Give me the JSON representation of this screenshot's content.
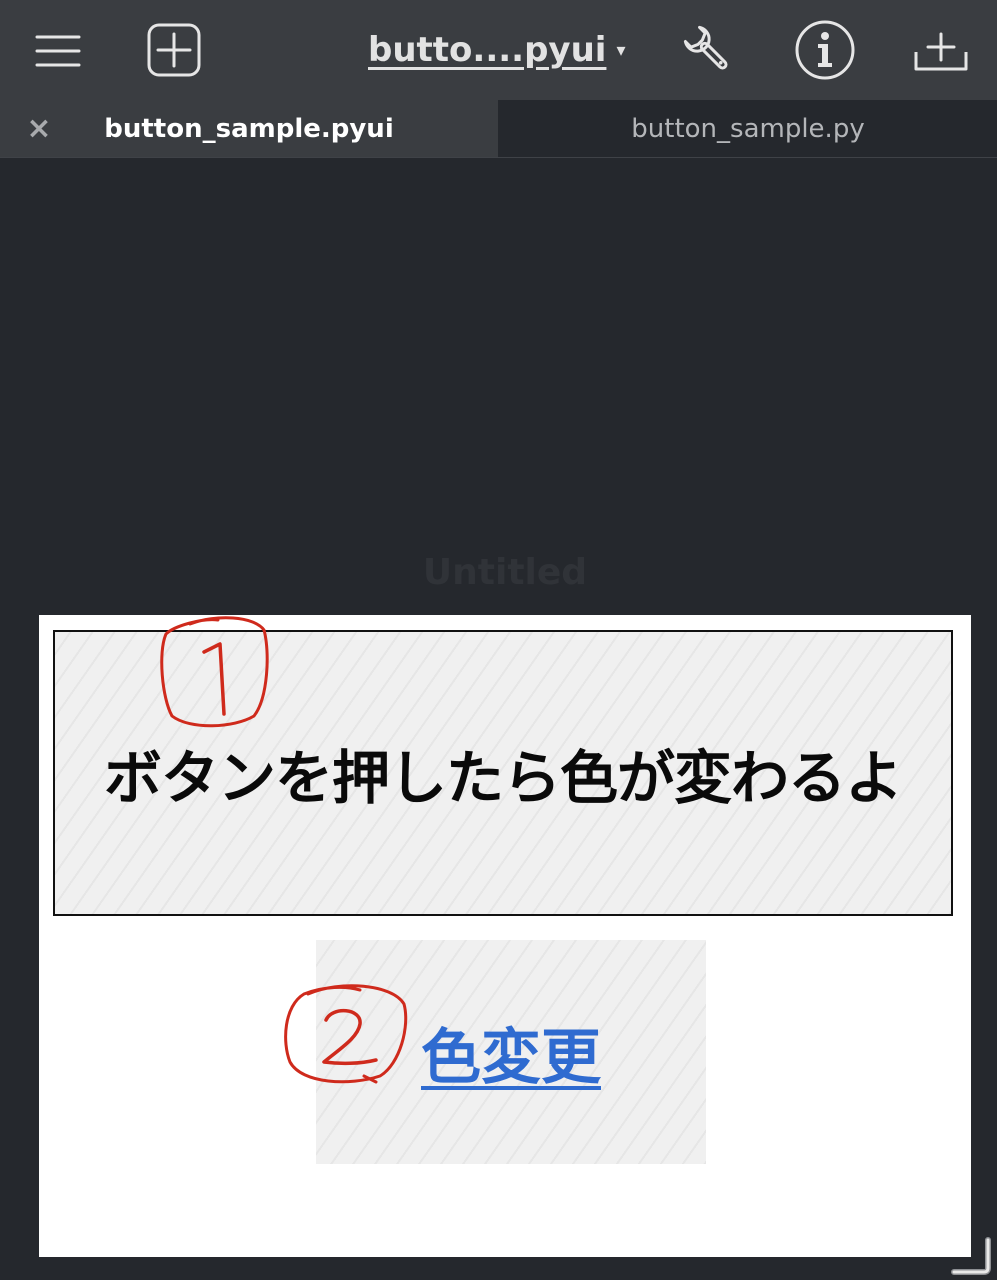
{
  "toolbar": {
    "menu_icon": "hamburger-menu-icon",
    "add_icon": "plus-square-icon",
    "title": "butto....pyui",
    "title_caret": "▾",
    "wrench_icon": "wrench-icon",
    "info_icon": "info-circle-icon",
    "add_subview_icon": "add-tray-icon"
  },
  "tabs": [
    {
      "label": "button_sample.pyui",
      "active": true,
      "close": "×"
    },
    {
      "label": "button_sample.py",
      "active": false
    }
  ],
  "view": {
    "title": "Untitled",
    "label_text": "ボタンを押したら色が変わるよ",
    "button_text": "色変更"
  },
  "annotations": [
    "1",
    "2"
  ],
  "colors": {
    "toolbar_bg": "#3a3d41",
    "editor_bg": "#25282d",
    "canvas_bg": "#ffffff",
    "button_text": "#2f6bd0",
    "annotation": "#cf2a1c"
  }
}
